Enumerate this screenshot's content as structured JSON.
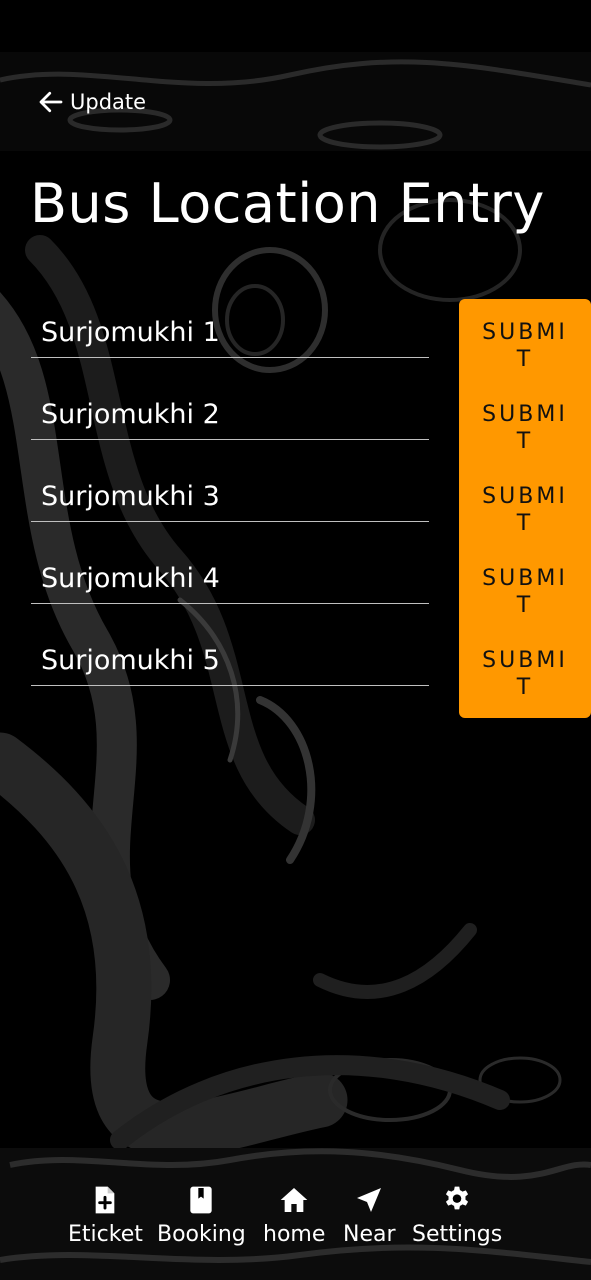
{
  "header": {
    "back_label": "Update"
  },
  "page": {
    "title": "Bus Location Entry"
  },
  "entries": [
    {
      "value": "Surjomukhi 1",
      "submit_label": "SUBMIT"
    },
    {
      "value": "Surjomukhi 2",
      "submit_label": "SUBMIT"
    },
    {
      "value": "Surjomukhi 3",
      "submit_label": "SUBMIT"
    },
    {
      "value": "Surjomukhi 4",
      "submit_label": "SUBMIT"
    },
    {
      "value": "Surjomukhi 5",
      "submit_label": "SUBMIT"
    }
  ],
  "bottom_nav": [
    {
      "label": "Eticket",
      "icon": "file-plus-icon"
    },
    {
      "label": "Booking",
      "icon": "bookmark-icon"
    },
    {
      "label": "home",
      "icon": "home-icon"
    },
    {
      "label": "Near",
      "icon": "navigation-arrow-icon"
    },
    {
      "label": "Settings",
      "icon": "gear-icon"
    }
  ],
  "colors": {
    "accent": "#ff9800",
    "background": "#000000",
    "text": "#ffffff",
    "underline": "#bfbfbf"
  }
}
